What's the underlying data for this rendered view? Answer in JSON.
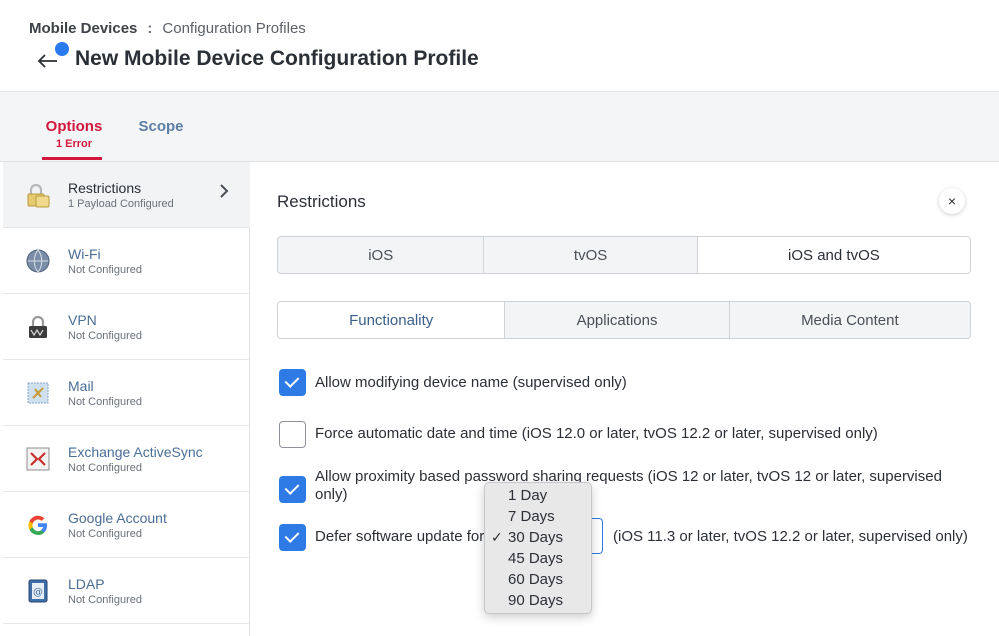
{
  "breadcrumb": {
    "root": "Mobile Devices",
    "separator": ":",
    "current": "Configuration Profiles"
  },
  "page_title": "New Mobile Device Configuration Profile",
  "tabs": [
    {
      "label": "Options",
      "sub": "1 Error",
      "active": true
    },
    {
      "label": "Scope",
      "active": false
    }
  ],
  "sidebar": {
    "items": [
      {
        "title": "Restrictions",
        "status": "1 Payload Configured",
        "icon": "padlock-icon",
        "active": true
      },
      {
        "title": "Wi-Fi",
        "status": "Not Configured",
        "icon": "globe-icon"
      },
      {
        "title": "VPN",
        "status": "Not Configured",
        "icon": "vpn-lock-icon"
      },
      {
        "title": "Mail",
        "status": "Not Configured",
        "icon": "mail-stamp-icon"
      },
      {
        "title": "Exchange ActiveSync",
        "status": "Not Configured",
        "icon": "exchange-icon"
      },
      {
        "title": "Google Account",
        "status": "Not Configured",
        "icon": "google-icon"
      },
      {
        "title": "LDAP",
        "status": "Not Configured",
        "icon": "address-book-icon"
      }
    ]
  },
  "main": {
    "section_title": "Restrictions",
    "close_glyph": "×",
    "platform_tabs": [
      "iOS",
      "tvOS",
      "iOS and tvOS"
    ],
    "platform_selected": "iOS and tvOS",
    "category_tabs": [
      "Functionality",
      "Applications",
      "Media Content"
    ],
    "category_selected": "Functionality",
    "options": [
      {
        "label": "Allow modifying device name (supervised only)",
        "checked": true
      },
      {
        "label": "Force automatic date and time (iOS 12.0 or later, tvOS 12.2 or later, supervised only)",
        "checked": false
      },
      {
        "label_line1": "Allow proximity based password sharing requests (iOS 12 or later, tvOS 12 or later, supervised",
        "label_line2": "only)",
        "checked": true
      },
      {
        "label": "Defer software update for",
        "suffix": "(iOS 11.3 or later, tvOS 12.2 or later, supervised only)",
        "checked": true
      }
    ],
    "defer_dropdown": {
      "options": [
        "1 Day",
        "7 Days",
        "30 Days",
        "45 Days",
        "60 Days",
        "90 Days"
      ],
      "selected": "30 Days",
      "check_glyph": "✓"
    }
  },
  "colors": {
    "accent": "#2f7be6",
    "error": "#d4183d",
    "link": "#4a6e96"
  }
}
